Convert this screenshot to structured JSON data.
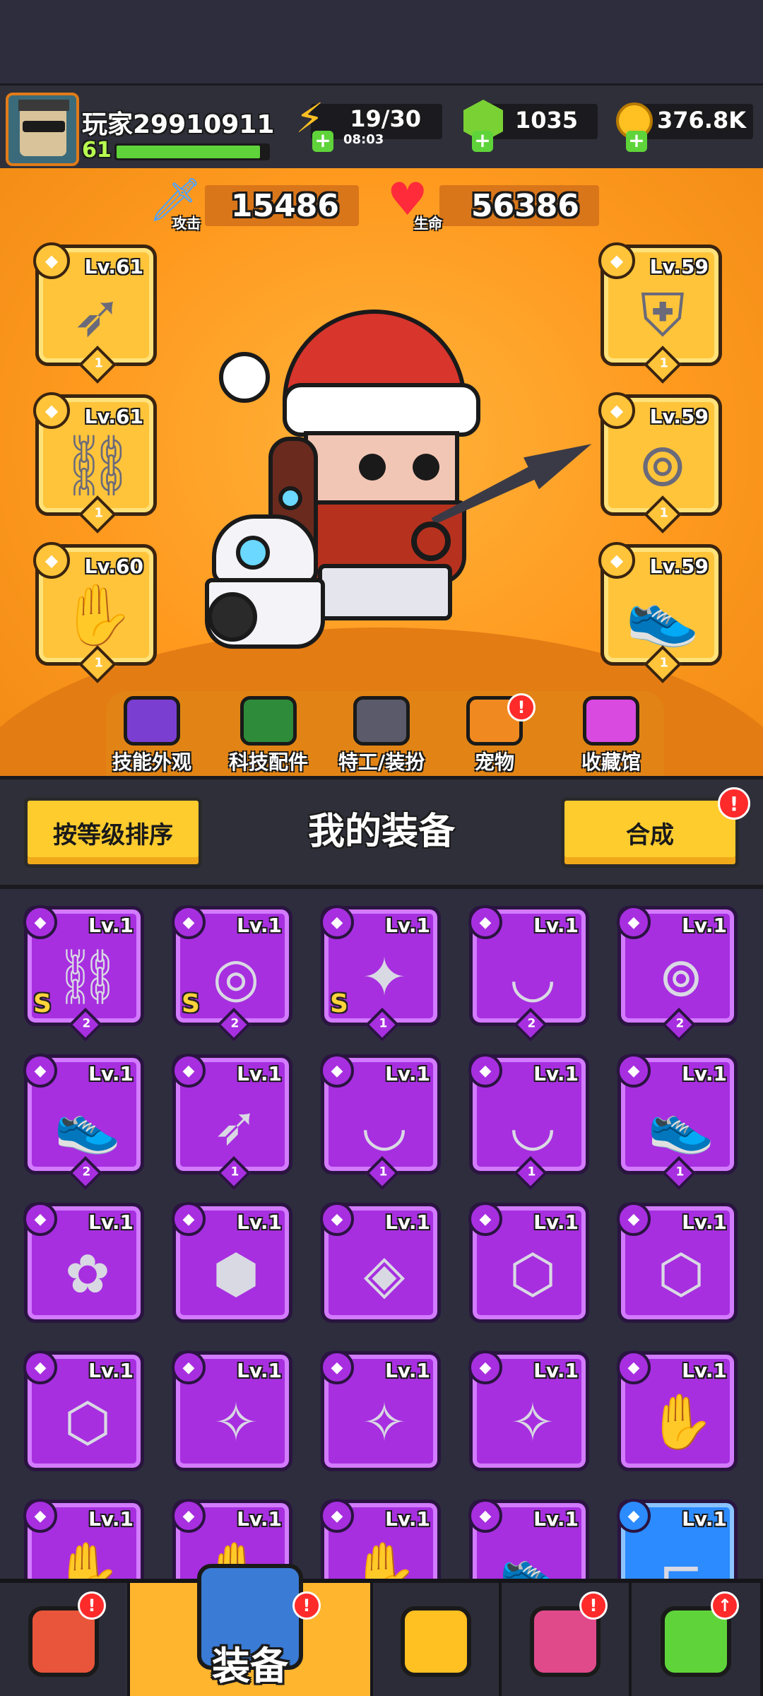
{
  "player": {
    "name": "玩家29910911",
    "level": "61",
    "xp_fraction": 0.95
  },
  "resources": {
    "energy": {
      "value": "19/30",
      "timer": "08:03"
    },
    "gems": {
      "value": "1035"
    },
    "gold": {
      "value": "376.8K"
    }
  },
  "stats": {
    "attack": {
      "label": "攻击",
      "value": "15486"
    },
    "life": {
      "label": "生命",
      "value": "56386"
    }
  },
  "equipped": {
    "left": [
      {
        "level": "Lv.61",
        "count": "1",
        "icon": "kunai-icon"
      },
      {
        "level": "Lv.61",
        "count": "1",
        "icon": "necklace-icon"
      },
      {
        "level": "Lv.60",
        "count": "1",
        "icon": "glove-icon"
      }
    ],
    "right": [
      {
        "level": "Lv.59",
        "count": "1",
        "icon": "armor-icon"
      },
      {
        "level": "Lv.59",
        "count": "1",
        "icon": "belt-icon"
      },
      {
        "level": "Lv.59",
        "count": "1",
        "icon": "boots-icon"
      }
    ]
  },
  "feature_tabs": [
    {
      "label": "技能外观",
      "icon": "skill-skin-icon"
    },
    {
      "label": "科技配件",
      "icon": "tech-part-icon"
    },
    {
      "label": "特工/装扮",
      "icon": "agent-icon"
    },
    {
      "label": "宠物",
      "icon": "pet-icon",
      "badge": "!"
    },
    {
      "label": "收藏馆",
      "icon": "collection-icon"
    }
  ],
  "equipment_header": {
    "sort_label": "按等级排序",
    "title": "我的装备",
    "merge_label": "合成",
    "merge_badge": "!"
  },
  "inventory": [
    {
      "level": "Lv.1",
      "rank": "S",
      "count": "2",
      "icon": "necklace-icon"
    },
    {
      "level": "Lv.1",
      "rank": "S",
      "count": "2",
      "icon": "ring-icon"
    },
    {
      "level": "Lv.1",
      "rank": "S",
      "count": "1",
      "icon": "dark-kunai-icon"
    },
    {
      "level": "Lv.1",
      "rank": "",
      "count": "2",
      "icon": "fang-necklace-icon"
    },
    {
      "level": "Lv.1",
      "rank": "",
      "count": "2",
      "icon": "belt-icon"
    },
    {
      "level": "Lv.1",
      "rank": "",
      "count": "2",
      "icon": "boots-icon"
    },
    {
      "level": "Lv.1",
      "rank": "",
      "count": "1",
      "icon": "kunai-icon"
    },
    {
      "level": "Lv.1",
      "rank": "",
      "count": "1",
      "icon": "fang-necklace-icon"
    },
    {
      "level": "Lv.1",
      "rank": "",
      "count": "1",
      "icon": "fang-necklace-icon"
    },
    {
      "level": "Lv.1",
      "rank": "",
      "count": "1",
      "icon": "boots-icon"
    },
    {
      "level": "Lv.1",
      "rank": "",
      "count": "",
      "icon": "green-armor-icon"
    },
    {
      "level": "Lv.1",
      "rank": "",
      "count": "",
      "icon": "stone-armor-icon"
    },
    {
      "level": "Lv.1",
      "rank": "",
      "count": "",
      "icon": "emerald-ring-icon"
    },
    {
      "level": "Lv.1",
      "rank": "",
      "count": "",
      "icon": "gold-belt-icon"
    },
    {
      "level": "Lv.1",
      "rank": "",
      "count": "",
      "icon": "gold-belt-icon"
    },
    {
      "level": "Lv.1",
      "rank": "",
      "count": "",
      "icon": "gold-belt-icon"
    },
    {
      "level": "Lv.1",
      "rank": "",
      "count": "",
      "icon": "blue-belt-icon"
    },
    {
      "level": "Lv.1",
      "rank": "",
      "count": "",
      "icon": "blue-belt-icon"
    },
    {
      "level": "Lv.1",
      "rank": "",
      "count": "",
      "icon": "blue-belt-icon"
    },
    {
      "level": "Lv.1",
      "rank": "",
      "count": "",
      "icon": "glove-icon"
    },
    {
      "level": "Lv.1",
      "rank": "",
      "count": "",
      "icon": "glove-icon"
    },
    {
      "level": "Lv.1",
      "rank": "",
      "count": "",
      "icon": "glove-icon"
    },
    {
      "level": "Lv.1",
      "rank": "",
      "count": "",
      "icon": "glove-icon"
    },
    {
      "level": "Lv.1",
      "rank": "",
      "count": "",
      "icon": "boots-icon"
    },
    {
      "level": "Lv.1",
      "rank": "",
      "count": "",
      "icon": "revolver-icon",
      "rarity": "blue"
    }
  ],
  "bottom_nav": [
    {
      "label": "",
      "icon": "shop-icon",
      "badge": "!"
    },
    {
      "label": "装备",
      "icon": "equipment-icon",
      "badge": "!",
      "active": true
    },
    {
      "label": "",
      "icon": "battle-star-icon"
    },
    {
      "label": "",
      "icon": "gacha-ball-icon",
      "badge": "!"
    },
    {
      "label": "",
      "icon": "dna-capsule-icon",
      "badge": "↑"
    }
  ]
}
